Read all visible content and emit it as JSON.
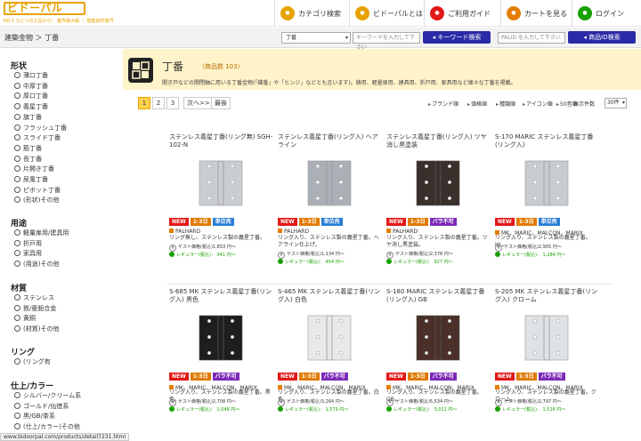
{
  "header": {
    "logo": "ビドーパル",
    "tagline": "NO.1 ひとつの工具から！ 業界最大級 ｜ 建築資材専門",
    "nav": [
      {
        "label": "カテゴリ検索",
        "icon": "category-icon",
        "color": "#e8a200"
      },
      {
        "label": "ビドーパルとは",
        "icon": "info-icon",
        "color": "#e8a200"
      },
      {
        "label": "ご利用ガイド",
        "icon": "guide-icon",
        "color": "#e31818"
      },
      {
        "label": "カートを見る",
        "icon": "cart-icon",
        "color": "#e57e00"
      },
      {
        "label": "ログイン",
        "icon": "login-icon",
        "color": "#18a000"
      }
    ]
  },
  "breadcrumb": "建築金物 ＞ 丁番",
  "search": {
    "category_value": "丁番",
    "keyword_placeholder": "キーワードを入力して下さい",
    "keyword_button": "キーワード検索",
    "product_placeholder": "PALID を入力して下さい",
    "product_button": "商品ID検索"
  },
  "sidebar": {
    "sections": [
      {
        "title": "形状",
        "items": [
          "薄口丁番",
          "中厚丁番",
          "厚口丁番",
          "義星丁番",
          "旗丁番",
          "フラッシュ丁番",
          "スライド丁番",
          "筋丁番",
          "長丁番",
          "片開き丁番",
          "尿風丁番",
          "ピボット丁番",
          "(形状)その他"
        ]
      },
      {
        "title": "用途",
        "items": [
          "軽量扉用/建具用",
          "折戸用",
          "家具用",
          "(用途)その他"
        ]
      },
      {
        "title": "材質",
        "items": [
          "ステンレス",
          "鉄/亜鉛合金",
          "黄銅",
          "(材質)その他"
        ]
      },
      {
        "title": "リング",
        "items": [
          "(リング有"
        ]
      },
      {
        "title": "仕上/カラー",
        "items": [
          "シルバー/クリーム系",
          "ゴールド/仙徳系",
          "黒/GB/茶系",
          "(仕上/カラー)その他"
        ]
      }
    ]
  },
  "banner": {
    "title": "丁番",
    "count": "（商品数 103）",
    "desc": "開き戸などの開閉軸に用いる丁番金物(「蝶番」や「ヒンジ」などとも言います)。鋳用、軽量扉用、建具用、折戸用、家具用など様々な丁番を掲載。"
  },
  "pagination": {
    "pages": [
      "1",
      "2",
      "3"
    ],
    "next": "次へ>>",
    "last": "最後"
  },
  "sort": {
    "options": [
      "ブランド順",
      "価格順",
      "種類順",
      "アイコン順",
      "50音順"
    ],
    "per_page_label": "表示件数",
    "per_page_value": "30件"
  },
  "products": [
    {
      "name": "ステンレス義星丁番(リング無) SGH-102-N",
      "badges": [
        "NEW",
        "1-3日",
        "単位売"
      ],
      "brand": "PALHARD",
      "desc": "リング無し、ステンレス製の義星丁番。",
      "price_tax": "ゲスト価格(税込)1,853 円〜",
      "price_reg": "レギュラー(税込)： 341 円〜",
      "color": "#c9cdd2"
    },
    {
      "name": "ステンレス義星丁番(リング入) ヘアライン",
      "badges": [
        "NEW",
        "1-3日",
        "単位売"
      ],
      "brand": "PALHARD",
      "desc": "リング入り、ステンレス製の義星丁番。ヘアライン仕上げ。",
      "price_tax": "ゲスト価格(税込)1,134 円〜",
      "price_reg": "レギュラー(税込)： 454 円〜",
      "color": "#aab0b6"
    },
    {
      "name": "ステンレス義星丁番(リング入) ツヤ消し黒塗装",
      "badges": [
        "NEW",
        "1-3日",
        "パラ不可"
      ],
      "brand": "PALHARD",
      "desc": "リング入り、ステンレス製の義星丁番。ツヤ消し黒塗装。",
      "price_tax": "ゲスト価格(税込)2,376 円〜",
      "price_reg": "レギュラー(税込)： 927 円〜",
      "color": "#3a2f2b"
    },
    {
      "name": "S-170 MARIC ステンレス義星丁番(リング入)",
      "badges": [
        "NEW",
        "1-3日",
        "単位売"
      ],
      "brand": "MK、MARIC、MALCON、MARIX",
      "desc": "リング入り、ステンレス製の義星丁番。HL。",
      "price_tax": "ゲスト価格(税込)2,905 円〜",
      "price_reg": "レギュラー(税込)： 1,284 円〜",
      "color": "#c8ccd0"
    },
    {
      "name": "S-685 MK ステンレス義星丁番(リング入) 黒色",
      "badges": [
        "NEW",
        "1-3日",
        "パラ不可"
      ],
      "brand": "MK、MARIC、MALCON、MARIX",
      "desc": "リング入り、ステンレス製の義星丁番。黒色。",
      "price_tax": "ゲスト価格(税込)2,708 円〜",
      "price_reg": "レギュラー(税込)： 1,048 円〜",
      "color": "#1e1e1e"
    },
    {
      "name": "S-465 MK ステンレス義星丁番(リング入) 白色",
      "badges": [
        "NEW",
        "1-3日",
        "パラ不可"
      ],
      "brand": "MK、MARIC、MALCON、MARIX",
      "desc": "リング入り、ステンレス製の義星丁番。白色。",
      "price_tax": "ゲスト価格(税込)3,264 円〜",
      "price_reg": "レギュラー(税込)： 1,579 円〜",
      "color": "#e7e9ea"
    },
    {
      "name": "S-180 MARIC ステンレス義星丁番(リング入) GB",
      "badges": [
        "NEW",
        "1-3日",
        "パラ不可"
      ],
      "brand": "MK、MARIC、MALCON、MARIX",
      "desc": "リング入り、ステンレス製の義星丁番。GB。",
      "price_tax": "ゲスト価格(税込)5,534 円〜",
      "price_reg": "レギュラー(税込)： 3,011 円〜",
      "color": "#4a3028"
    },
    {
      "name": "S-205 MK ステンレス義星丁番(リング入) クローム",
      "badges": [
        "NEW",
        "1-3日",
        "パラ不可"
      ],
      "brand": "MK、MARIC、MALCON、MARIX",
      "desc": "リング入り、ステンレス製の義星丁番。クローム。",
      "price_tax": "ゲスト価格(税込)2,797 円〜",
      "price_reg": "レギュラー(税込)： 1,516 円〜",
      "color": "#dfe2e4"
    }
  ],
  "status_url": "www.bidoorpal.com/products/detail7231.html"
}
